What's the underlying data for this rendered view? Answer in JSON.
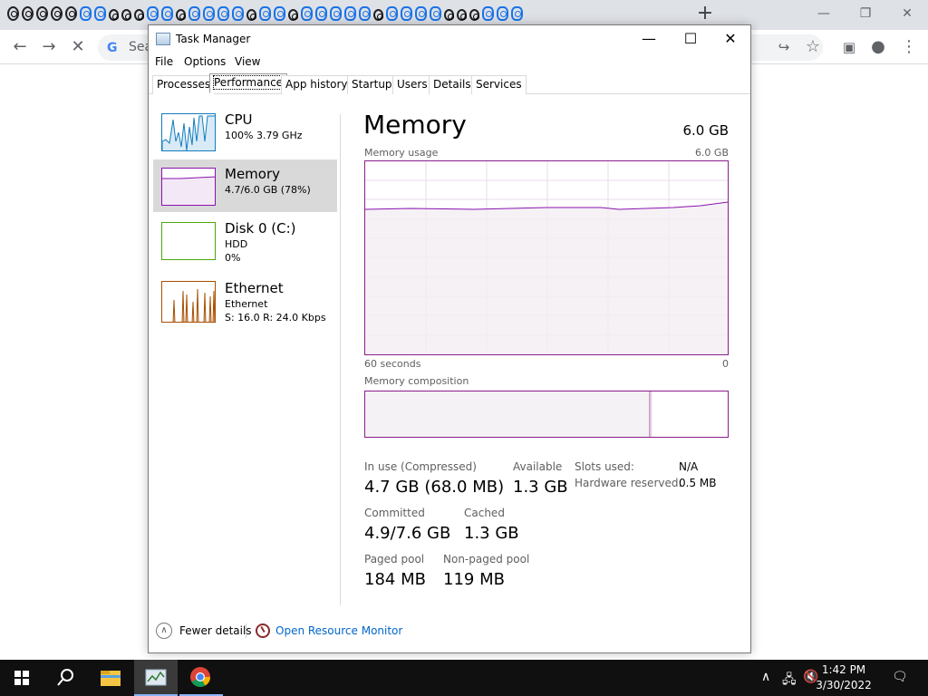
{
  "browser": {
    "tab_favicons": [
      "gear",
      "gear",
      "gear",
      "gear",
      "gear",
      "blue",
      "blue",
      "small",
      "small",
      "small",
      "blue",
      "blue",
      "small",
      "blue",
      "blue",
      "blue",
      "blue",
      "small",
      "blue",
      "blue",
      "small",
      "blue",
      "blue",
      "blue",
      "blue",
      "blue",
      "small",
      "blue",
      "blue",
      "blue",
      "blue",
      "small",
      "small",
      "small",
      "blue",
      "blue",
      "blue"
    ],
    "new_tab_label": "+",
    "omnibox_text": "Sea",
    "window_controls": [
      "minimize-icon",
      "restore-icon",
      "close-icon"
    ],
    "toolbar_icons": [
      "back-arrow-icon",
      "forward-arrow-icon",
      "stop-loading-icon",
      "share-icon",
      "star-icon",
      "side-panel-icon",
      "profile-icon",
      "more-menu-icon"
    ]
  },
  "task_manager": {
    "title": "Task Manager",
    "menu": [
      "File",
      "Options",
      "View"
    ],
    "tabs": [
      "Processes",
      "Performance",
      "App history",
      "Startup",
      "Users",
      "Details",
      "Services"
    ],
    "active_tab": "Performance",
    "resources": [
      {
        "name": "CPU",
        "line1": "100%  3.79 GHz",
        "line2": "",
        "color": "#117dbb"
      },
      {
        "name": "Memory",
        "line1": "4.7/6.0 GB (78%)",
        "line2": "",
        "color": "#8b12ae"
      },
      {
        "name": "Disk 0 (C:)",
        "line1": "HDD",
        "line2": "0%",
        "color": "#4da60c"
      },
      {
        "name": "Ethernet",
        "line1": "Ethernet",
        "line2": "S: 16.0  R: 24.0 Kbps",
        "color": "#a74f01"
      }
    ],
    "detail": {
      "heading": "Memory",
      "total": "6.0 GB",
      "usage_label": "Memory usage",
      "usage_max": "6.0 GB",
      "time_span": "60 seconds",
      "time_end": "0",
      "composition_label": "Memory composition",
      "in_use_label": "In use (Compressed)",
      "in_use_value": "4.7 GB (68.0 MB)",
      "available_label": "Available",
      "available_value": "1.3 GB",
      "committed_label": "Committed",
      "committed_value": "4.9/7.6 GB",
      "cached_label": "Cached",
      "cached_value": "1.3 GB",
      "paged_label": "Paged pool",
      "paged_value": "184 MB",
      "nonpaged_label": "Non-paged pool",
      "nonpaged_value": "119 MB",
      "slots_label": "Slots used:",
      "slots_value": "N/A",
      "hw_reserved_label": "Hardware reserved:",
      "hw_reserved_value": "0.5 MB",
      "usage_fraction": 0.78
    },
    "footer": {
      "fewer_details": "Fewer details",
      "open_resmon": "Open Resource Monitor"
    }
  },
  "taskbar": {
    "apps": [
      "search-icon",
      "file-explorer-icon",
      "task-manager-icon",
      "chrome-icon"
    ],
    "time": "1:42 PM",
    "date": "3/30/2022",
    "tray_icons": [
      "chevron-up-icon",
      "network-icon",
      "speaker-muted-icon"
    ]
  }
}
